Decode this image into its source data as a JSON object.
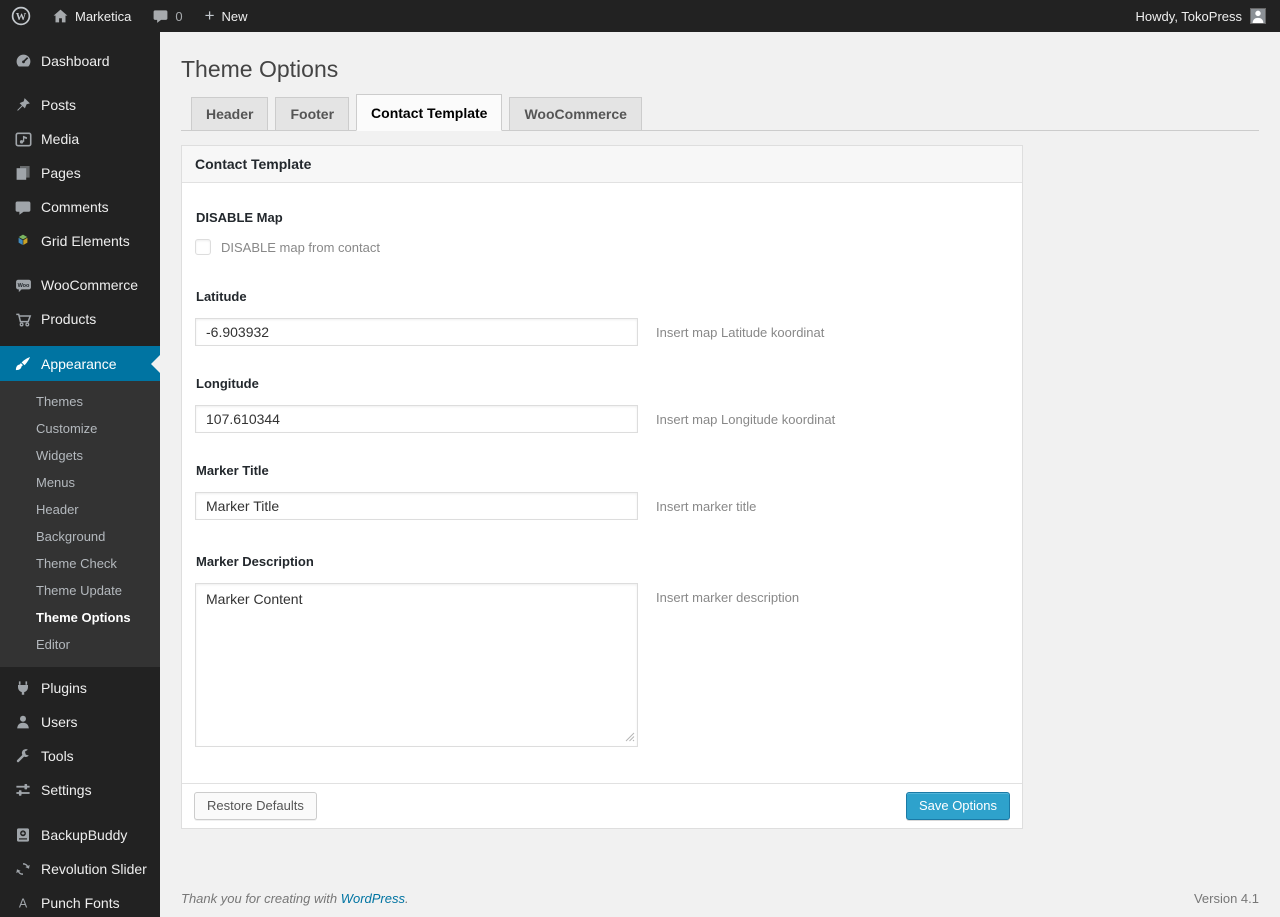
{
  "admin_bar": {
    "site_name": "Marketica",
    "comment_count": "0",
    "new_label": "New",
    "howdy": "Howdy, TokoPress"
  },
  "sidebar": {
    "dashboard": {
      "label": "Dashboard",
      "icon": "dashboard-icon"
    },
    "content_group": [
      {
        "label": "Posts",
        "icon": "pushpin-icon"
      },
      {
        "label": "Media",
        "icon": "media-icon"
      },
      {
        "label": "Pages",
        "icon": "pages-icon"
      },
      {
        "label": "Comments",
        "icon": "comment-icon"
      },
      {
        "label": "Grid Elements",
        "icon": "grid-elements-icon"
      }
    ],
    "commerce_group": [
      {
        "label": "WooCommerce",
        "icon": "woocommerce-icon"
      },
      {
        "label": "Products",
        "icon": "cart-icon"
      }
    ],
    "appearance": {
      "label": "Appearance",
      "icon": "paintbrush-icon",
      "active": true
    },
    "appearance_submenu": [
      "Themes",
      "Customize",
      "Widgets",
      "Menus",
      "Header",
      "Background",
      "Theme Check",
      "Theme Update",
      "Theme Options",
      "Editor"
    ],
    "current_submenu_item": "Theme Options",
    "admin_group": [
      {
        "label": "Plugins",
        "icon": "plug-icon"
      },
      {
        "label": "Users",
        "icon": "user-icon"
      },
      {
        "label": "Tools",
        "icon": "wrench-icon"
      },
      {
        "label": "Settings",
        "icon": "settings-icon"
      }
    ],
    "plugin_group": [
      {
        "label": "BackupBuddy",
        "icon": "backup-icon"
      },
      {
        "label": "Revolution Slider",
        "icon": "cycle-arrows-icon"
      },
      {
        "label": "Punch Fonts",
        "icon": "letter-a-icon"
      }
    ]
  },
  "page": {
    "title": "Theme Options",
    "tabs": [
      {
        "label": "Header",
        "active": false
      },
      {
        "label": "Footer",
        "active": false
      },
      {
        "label": "Contact Template",
        "active": true
      },
      {
        "label": "WooCommerce",
        "active": false
      }
    ],
    "panel_title": "Contact Template",
    "fields": {
      "disable_map": {
        "label": "DISABLE Map",
        "checkbox_label": "DISABLE map from contact",
        "checked": false
      },
      "latitude": {
        "label": "Latitude",
        "value": "-6.903932",
        "help": "Insert map Latitude koordinat"
      },
      "longitude": {
        "label": "Longitude",
        "value": "107.610344",
        "help": "Insert map Longitude koordinat"
      },
      "marker_title": {
        "label": "Marker Title",
        "value": "Marker Title",
        "help": "Insert marker title"
      },
      "marker_description": {
        "label": "Marker Description",
        "value": "Marker Content",
        "help": "Insert marker description"
      }
    },
    "buttons": {
      "restore": "Restore Defaults",
      "save": "Save Options"
    }
  },
  "footer": {
    "thanks_text": "Thank you for creating with ",
    "wordpress_link": "WordPress",
    "period": ".",
    "version": "Version 4.1"
  },
  "colors": {
    "admin_bar_bg": "#222222",
    "menu_bg": "#222222",
    "submenu_bg": "#333333",
    "highlight": "#0074a2",
    "primary_button": "#2ea2cc",
    "link": "#0074a2",
    "page_bg": "#f1f1f1"
  }
}
